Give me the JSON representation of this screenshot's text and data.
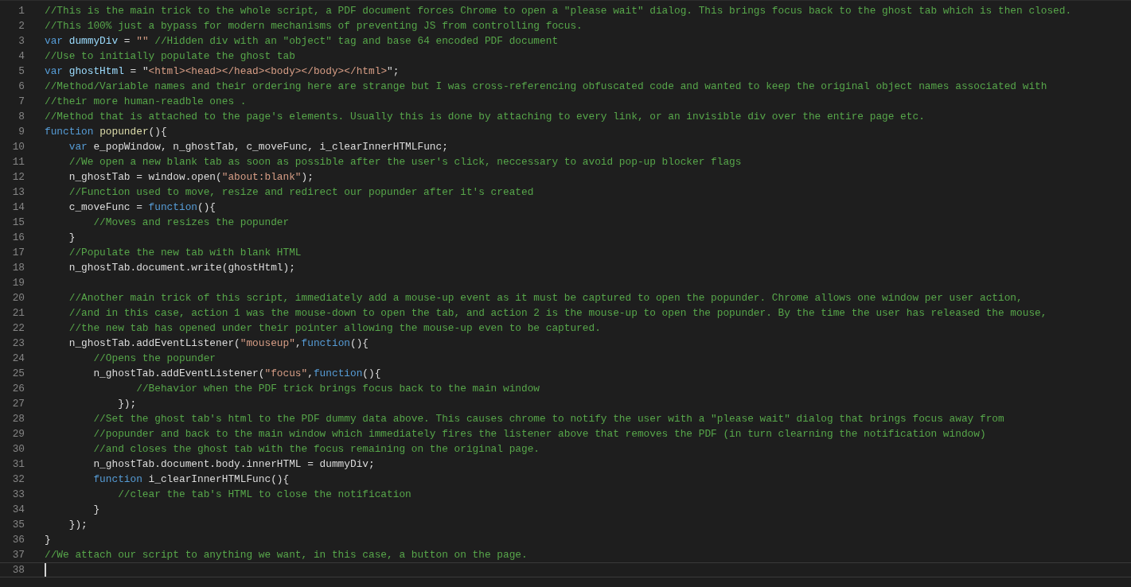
{
  "editor": {
    "lines": [
      {
        "number": "1",
        "current": false,
        "tokens": [
          {
            "kind": "comment",
            "text": "//This is the main trick to the whole script, a PDF document forces Chrome to open a \"please wait\" dialog. This brings focus back to the ghost tab which is then closed."
          }
        ]
      },
      {
        "number": "2",
        "current": false,
        "tokens": [
          {
            "kind": "comment",
            "text": "//This 100% just a bypass for modern mechanisms of preventing JS from controlling focus."
          }
        ]
      },
      {
        "number": "3",
        "current": false,
        "tokens": [
          {
            "kind": "keyword",
            "text": "var "
          },
          {
            "kind": "variable",
            "text": "dummyDiv"
          },
          {
            "kind": "plain",
            "text": " = "
          },
          {
            "kind": "string",
            "text": "\"\""
          },
          {
            "kind": "comment",
            "text": " //Hidden div with an \"object\" tag and base 64 encoded PDF document"
          }
        ]
      },
      {
        "number": "4",
        "current": false,
        "tokens": [
          {
            "kind": "comment",
            "text": "//Use to initially populate the ghost tab"
          }
        ]
      },
      {
        "number": "5",
        "current": false,
        "tokens": [
          {
            "kind": "keyword",
            "text": "var "
          },
          {
            "kind": "variable",
            "text": "ghostHtml"
          },
          {
            "kind": "plain",
            "text": " = \""
          },
          {
            "kind": "string",
            "text": "<html><head></head><body></body></html>"
          },
          {
            "kind": "plain",
            "text": "\";"
          }
        ]
      },
      {
        "number": "6",
        "current": false,
        "tokens": [
          {
            "kind": "comment",
            "text": "//Method/Variable names and their ordering here are strange but I was cross-referencing obfuscated code and wanted to keep the original object names associated with"
          }
        ]
      },
      {
        "number": "7",
        "current": false,
        "tokens": [
          {
            "kind": "comment",
            "text": "//their more human-readble ones ."
          }
        ]
      },
      {
        "number": "8",
        "current": false,
        "tokens": [
          {
            "kind": "comment",
            "text": "//Method that is attached to the page's elements. Usually this is done by attaching to every link, or an invisible div over the entire page etc."
          }
        ]
      },
      {
        "number": "9",
        "current": false,
        "tokens": [
          {
            "kind": "keyword",
            "text": "function "
          },
          {
            "kind": "function",
            "text": "popunder"
          },
          {
            "kind": "plain",
            "text": "(){"
          }
        ]
      },
      {
        "number": "10",
        "current": false,
        "tokens": [
          {
            "kind": "keyword",
            "text": "    var"
          },
          {
            "kind": "plain",
            "text": " e_popWindow, n_ghostTab, c_moveFunc, i_clearInnerHTMLFunc;"
          }
        ]
      },
      {
        "number": "11",
        "current": false,
        "tokens": [
          {
            "kind": "comment",
            "text": "    //We open a new blank tab as soon as possible after the user's click, neccessary to avoid pop-up blocker flags"
          }
        ]
      },
      {
        "number": "12",
        "current": false,
        "tokens": [
          {
            "kind": "plain",
            "text": "    n_ghostTab = window.open("
          },
          {
            "kind": "string",
            "text": "\"about:blank\""
          },
          {
            "kind": "plain",
            "text": ");"
          }
        ]
      },
      {
        "number": "13",
        "current": false,
        "tokens": [
          {
            "kind": "comment",
            "text": "    //Function used to move, resize and redirect our popunder after it's created"
          }
        ]
      },
      {
        "number": "14",
        "current": false,
        "tokens": [
          {
            "kind": "plain",
            "text": "    c_moveFunc = "
          },
          {
            "kind": "keyword",
            "text": "function"
          },
          {
            "kind": "plain",
            "text": "(){"
          }
        ]
      },
      {
        "number": "15",
        "current": false,
        "tokens": [
          {
            "kind": "comment",
            "text": "        //Moves and resizes the popunder"
          }
        ]
      },
      {
        "number": "16",
        "current": false,
        "tokens": [
          {
            "kind": "plain",
            "text": "    }"
          }
        ]
      },
      {
        "number": "17",
        "current": false,
        "tokens": [
          {
            "kind": "comment",
            "text": "    //Populate the new tab with blank HTML"
          }
        ]
      },
      {
        "number": "18",
        "current": false,
        "tokens": [
          {
            "kind": "plain",
            "text": "    n_ghostTab.document.write(ghostHtml);"
          }
        ]
      },
      {
        "number": "19",
        "current": false
      },
      {
        "number": "20",
        "current": false,
        "tokens": [
          {
            "kind": "comment",
            "text": "    //Another main trick of this script, immediately add a mouse-up event as it must be captured to open the popunder. Chrome allows one window per user action,"
          }
        ]
      },
      {
        "number": "21",
        "current": false,
        "tokens": [
          {
            "kind": "comment",
            "text": "    //and in this case, action 1 was the mouse-down to open the tab, and action 2 is the mouse-up to open the popunder. By the time the user has released the mouse,"
          }
        ]
      },
      {
        "number": "22",
        "current": false,
        "tokens": [
          {
            "kind": "comment",
            "text": "    //the new tab has opened under their pointer allowing the mouse-up even to be captured."
          }
        ]
      },
      {
        "number": "23",
        "current": false,
        "tokens": [
          {
            "kind": "plain",
            "text": "    n_ghostTab.addEventListener("
          },
          {
            "kind": "string",
            "text": "\"mouseup\""
          },
          {
            "kind": "plain",
            "text": ","
          },
          {
            "kind": "keyword",
            "text": "function"
          },
          {
            "kind": "plain",
            "text": "(){"
          }
        ]
      },
      {
        "number": "24",
        "current": false,
        "tokens": [
          {
            "kind": "comment",
            "text": "        //Opens the popunder"
          }
        ]
      },
      {
        "number": "25",
        "current": false,
        "tokens": [
          {
            "kind": "plain",
            "text": "        n_ghostTab.addEventListener("
          },
          {
            "kind": "string",
            "text": "\"focus\""
          },
          {
            "kind": "plain",
            "text": ","
          },
          {
            "kind": "keyword",
            "text": "function"
          },
          {
            "kind": "plain",
            "text": "(){"
          }
        ]
      },
      {
        "number": "26",
        "current": false,
        "tokens": [
          {
            "kind": "comment",
            "text": "               //Behavior when the PDF trick brings focus back to the main window"
          }
        ]
      },
      {
        "number": "27",
        "current": false,
        "tokens": [
          {
            "kind": "plain",
            "text": "            });"
          }
        ]
      },
      {
        "number": "28",
        "current": false,
        "tokens": [
          {
            "kind": "comment",
            "text": "        //Set the ghost tab's html to the PDF dummy data above. This causes chrome to notify the user with a \"please wait\" dialog that brings focus away from"
          }
        ]
      },
      {
        "number": "29",
        "current": false,
        "tokens": [
          {
            "kind": "comment",
            "text": "        //popunder and back to the main window which immediately fires the listener above that removes the PDF (in turn clearning the notification window)"
          }
        ]
      },
      {
        "number": "30",
        "current": false,
        "tokens": [
          {
            "kind": "comment",
            "text": "        //and closes the ghost tab with the focus remaining on the original page."
          }
        ]
      },
      {
        "number": "31",
        "current": false,
        "tokens": [
          {
            "kind": "plain",
            "text": "        n_ghostTab.document.body.innerHTML = dummyDiv;"
          }
        ]
      },
      {
        "number": "32",
        "current": false,
        "tokens": [
          {
            "kind": "keyword",
            "text": "        function"
          },
          {
            "kind": "plain",
            "text": " i_clearInnerHTMLFunc(){"
          }
        ]
      },
      {
        "number": "33",
        "current": false,
        "tokens": [
          {
            "kind": "comment",
            "text": "            //clear the tab's HTML to close the notification"
          }
        ]
      },
      {
        "number": "34",
        "current": false,
        "tokens": [
          {
            "kind": "plain",
            "text": "        }"
          }
        ]
      },
      {
        "number": "35",
        "current": false,
        "tokens": [
          {
            "kind": "plain",
            "text": "    });"
          }
        ]
      },
      {
        "number": "36",
        "current": false,
        "tokens": [
          {
            "kind": "plain",
            "text": "}"
          }
        ]
      },
      {
        "number": "37",
        "current": false,
        "tokens": [
          {
            "kind": "comment",
            "text": "//We attach our script to anything we want, in this case, a button on the page."
          }
        ]
      },
      {
        "number": "38",
        "current": true
      }
    ]
  }
}
